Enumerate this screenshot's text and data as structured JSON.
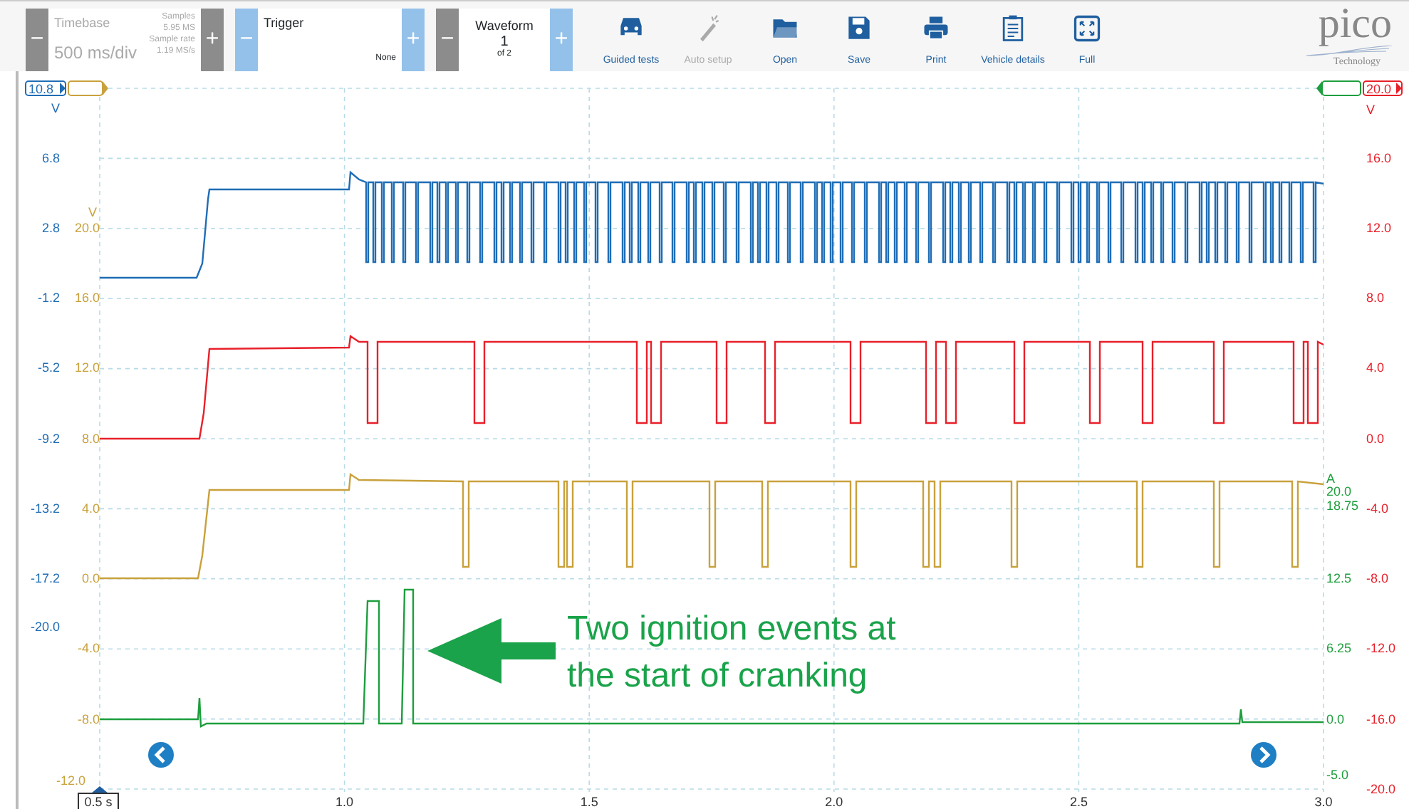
{
  "toolbar": {
    "timebase": {
      "decrement": "−",
      "label": "Timebase",
      "value": "500 ms/div",
      "samples_label": "Samples",
      "samples": "5.95 MS",
      "rate_label": "Sample rate",
      "rate": "1.19 MS/s",
      "increment": "+"
    },
    "trigger": {
      "decrement": "−",
      "label": "Trigger",
      "value": "None",
      "increment": "+"
    },
    "waveform": {
      "decrement": "−",
      "label": "Waveform",
      "value": "1",
      "of": "of 2",
      "increment": "+"
    },
    "buttons": [
      {
        "label": "Guided tests",
        "disabled": false
      },
      {
        "label": "Auto setup",
        "disabled": true
      },
      {
        "label": "Open",
        "disabled": false
      },
      {
        "label": "Save",
        "disabled": false
      },
      {
        "label": "Print",
        "disabled": false
      },
      {
        "label": "Vehicle details",
        "disabled": false
      },
      {
        "label": "Full",
        "disabled": false
      }
    ],
    "logo": {
      "text": "pico",
      "subtitle": "Technology"
    }
  },
  "channels": [
    {
      "color": "#1f6db5",
      "unit": "V",
      "scale": "10.8",
      "ticks": [
        "6.8",
        "2.8",
        "-1.2",
        "-5.2",
        "-9.2",
        "-13.2",
        "-17.2",
        "-20.0"
      ]
    },
    {
      "color": "#c9a13c",
      "unit": "V",
      "ticks": [
        "20.0",
        "16.0",
        "12.0",
        "8.0",
        "4.0",
        "0.0",
        "-4.0",
        "-8.0",
        "-12.0"
      ]
    },
    {
      "color": "#e8202a",
      "unit": "V",
      "scale": "20.0",
      "ticks": [
        "16.0",
        "12.0",
        "8.0",
        "4.0",
        "0.0",
        "-4.0",
        "-8.0",
        "-12.0",
        "-16.0",
        "-20.0"
      ]
    },
    {
      "color": "#1e9e3e",
      "unit": "A",
      "ticks": [
        "20.0",
        "18.75",
        "12.5",
        "6.25",
        "0.0",
        "-5.0"
      ]
    }
  ],
  "time_axis": {
    "cursor": "0.5 s",
    "ticks": [
      "1.0",
      "1.5",
      "2.0",
      "2.5",
      "3.0"
    ]
  },
  "annotation": {
    "lines": [
      "Two ignition events at",
      "the start of cranking"
    ]
  }
}
